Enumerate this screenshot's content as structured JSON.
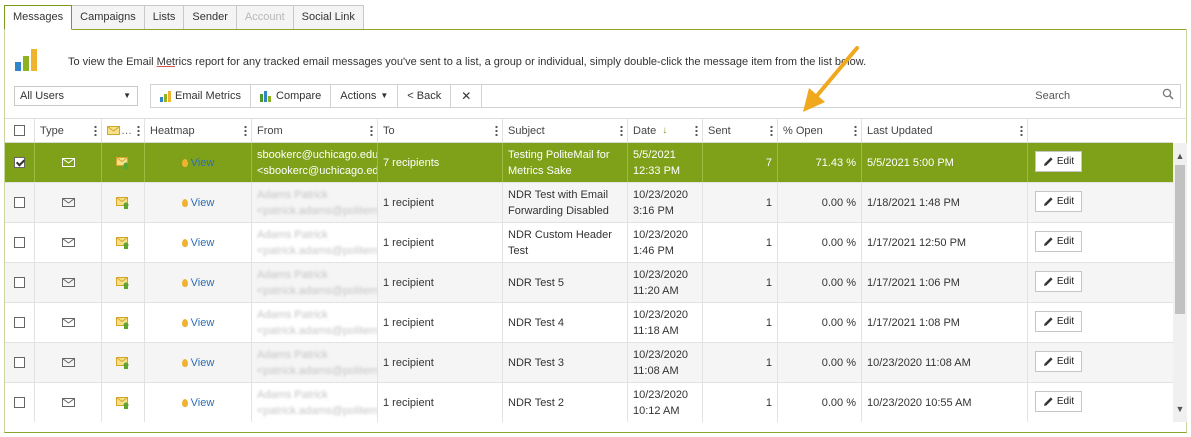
{
  "tabs": [
    {
      "label": "Messages",
      "state": "active"
    },
    {
      "label": "Campaigns",
      "state": "normal"
    },
    {
      "label": "Lists",
      "state": "normal"
    },
    {
      "label": "Sender",
      "state": "normal"
    },
    {
      "label": "Account",
      "state": "disabled"
    },
    {
      "label": "Social Link",
      "state": "normal"
    }
  ],
  "info": {
    "text_before": "To view the Email ",
    "text_underlined": "Met",
    "text_after": "rics report for any tracked email messages you've sent to a list, a group or individual, simply double-click the message item from the list below."
  },
  "filter": {
    "selected": "All Users"
  },
  "toolbar": {
    "email_metrics": "Email Metrics",
    "compare": "Compare",
    "actions": "Actions",
    "back": "< Back",
    "clear": "✕",
    "search_label": "Search"
  },
  "columns": {
    "type": "Type",
    "heatmap": "Heatmap",
    "from": "From",
    "to": "To",
    "subject": "Subject",
    "date": "Date",
    "sent": "Sent",
    "open": "% Open",
    "updated": "Last Updated",
    "sort_indicator": "↓"
  },
  "rows": [
    {
      "checked": true,
      "heatmap": "View",
      "from1": "sbookerc@uchicago.edu",
      "from2": "<sbookerc@uchicago.edu>",
      "to": "7 recipients",
      "subject1": "Testing PoliteMail for",
      "subject2": "Metrics Sake",
      "date1": "5/5/2021",
      "date2": "12:33 PM",
      "sent": "7",
      "open": "71.43 %",
      "updated": "5/5/2021 5:00 PM",
      "edit": "Edit"
    },
    {
      "checked": false,
      "heatmap": "View",
      "from1": "Adams Patrick",
      "from2": "<patrick.adams@politemail",
      "to": "1 recipient",
      "subject1": "NDR Test with Email",
      "subject2": "Forwarding Disabled",
      "date1": "10/23/2020",
      "date2": "3:16 PM",
      "sent": "1",
      "open": "0.00 %",
      "updated": "1/18/2021 1:48 PM",
      "edit": "Edit"
    },
    {
      "checked": false,
      "heatmap": "View",
      "from1": "Adams Patrick",
      "from2": "<patrick.adams@politemail",
      "to": "1 recipient",
      "subject1": "NDR Custom Header",
      "subject2": "Test",
      "date1": "10/23/2020",
      "date2": "1:46 PM",
      "sent": "1",
      "open": "0.00 %",
      "updated": "1/17/2021 12:50 PM",
      "edit": "Edit"
    },
    {
      "checked": false,
      "heatmap": "View",
      "from1": "Adams Patrick",
      "from2": "<patrick.adams@politemail",
      "to": "1 recipient",
      "subject1": "NDR Test 5",
      "subject2": "",
      "date1": "10/23/2020",
      "date2": "11:20 AM",
      "sent": "1",
      "open": "0.00 %",
      "updated": "1/17/2021 1:06 PM",
      "edit": "Edit"
    },
    {
      "checked": false,
      "heatmap": "View",
      "from1": "Adams Patrick",
      "from2": "<patrick.adams@politemail",
      "to": "1 recipient",
      "subject1": "NDR Test 4",
      "subject2": "",
      "date1": "10/23/2020",
      "date2": "11:18 AM",
      "sent": "1",
      "open": "0.00 %",
      "updated": "1/17/2021 1:08 PM",
      "edit": "Edit"
    },
    {
      "checked": false,
      "heatmap": "View",
      "from1": "Adams Patrick",
      "from2": "<patrick.adams@politemail",
      "to": "1 recipient",
      "subject1": "NDR Test 3",
      "subject2": "",
      "date1": "10/23/2020",
      "date2": "11:08 AM",
      "sent": "1",
      "open": "0.00 %",
      "updated": "10/23/2020 11:08 AM",
      "edit": "Edit"
    },
    {
      "checked": false,
      "heatmap": "View",
      "from1": "Adams Patrick",
      "from2": "<patrick.adams@politemail",
      "to": "1 recipient",
      "subject1": "NDR Test 2",
      "subject2": "",
      "date1": "10/23/2020",
      "date2": "10:12 AM",
      "sent": "1",
      "open": "0.00 %",
      "updated": "10/23/2020 10:55 AM",
      "edit": "Edit"
    }
  ],
  "colors": {
    "accent": "#7fa11a",
    "link": "#2f6db5",
    "annotation": "#f0a81e"
  }
}
